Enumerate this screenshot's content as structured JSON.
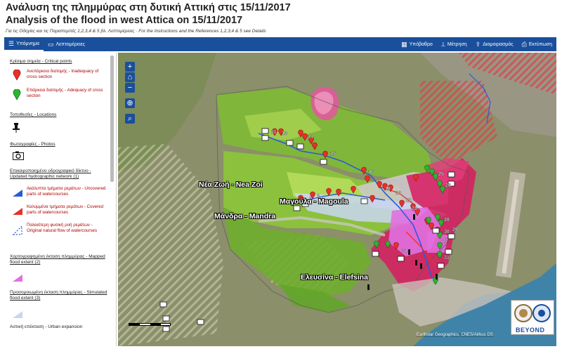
{
  "header": {
    "title_el": "Ανάλυση της πλημμύρας στη δυτική Αττική στις 15/11/2017",
    "title_en": "Analysis of the flood in west Attica on 15/11/2017",
    "subtitle": "Για τις Οδηγίες και τις Παραπομπές 1,2,3,4 & 5 βλ. Λεπτομέρειες · For the Instructions and the References 1,2,3,4 & 5 see Details"
  },
  "toolbar": {
    "legend_label": "Υπόμνημα",
    "details_label": "Λεπτομέρειες",
    "basemap_label": "Υπόβαθρο",
    "measure_label": "Μέτρηση",
    "share_label": "Διαμοιρασμός",
    "print_label": "Εκτύπωση"
  },
  "legend": {
    "critical_header": "Κρίσιμα σημεία - Critical points",
    "inadequacy": "Ανεπάρκεια διατομής - Inadequacy of cross section",
    "adequacy": "Επάρκεια διατομής - Adequacy of cross section",
    "locations_header": "Τοποθεσίες - Locations",
    "photos_header": "Φωτογραφίες - Photos",
    "hydro_header": "Επικαιροποιημένο υδρογραφικό δίκτυο - Updated hydrographic network (1)",
    "uncovered": "Ακάλυπτα τμήματα ρεμάτων - Uncovered parts of watercourses",
    "covered": "Καλυμμένα τμήματα ρεμάτων - Covered parts of watercourses",
    "original": "Παλαιότερη φυσική ροή ρεμάτων - Original natural flow of watercourses",
    "mapped_header": "Χαρτογραφημένη έκταση πλημμύρας - Mapped flood extent (2)",
    "simulated_header": "Προσομοιωμένη έκταση πλημμύρας - Simulated flood extent (3)",
    "urban_header": "Αστική επέκταση - Urban expansion"
  },
  "map": {
    "place_labels": [
      "Νέα Ζωή - Nea Zoi",
      "Μάνδρα - Mandra",
      "Μαγούλα - Magoula",
      "Ελευσίνα - Elefsina"
    ],
    "point_numbers": [
      "1",
      "2",
      "3",
      "11",
      "12",
      "13",
      "14",
      "15",
      "16",
      "18",
      "20",
      "22",
      "23",
      "25",
      "26",
      "27",
      "28",
      "29",
      "30",
      "31",
      "32"
    ],
    "attribution": "Earthstar Geographics, CNES/Airbus DS",
    "logo_text": "BEYOND",
    "colors": {
      "inadequacy": "#e8302a",
      "adequacy": "#2bb52f",
      "flood_mapped": "#e070e0",
      "urban": "#d81b60",
      "accent": "#1a4f9c"
    }
  }
}
